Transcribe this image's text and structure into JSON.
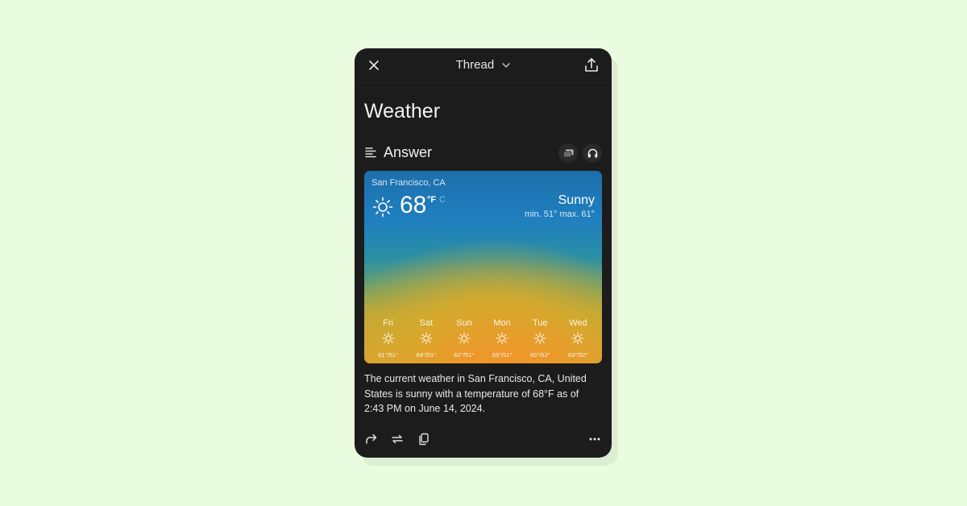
{
  "header": {
    "title": "Thread",
    "close_icon": "close-icon",
    "dropdown_icon": "chevron-down-icon",
    "share_icon": "share-icon"
  },
  "page": {
    "title": "Weather"
  },
  "answer": {
    "label": "Answer",
    "icons": [
      "answer-lines-icon",
      "images-icon",
      "headphones-icon"
    ]
  },
  "weather": {
    "location": "San Francisco, CA",
    "temperature": "68",
    "unit_primary": "°F",
    "unit_secondary": "C",
    "condition": "Sunny",
    "min_max": "min. 51° max. 61°",
    "icon": "sun-icon",
    "colors": {
      "top": "#1d6fab",
      "middle": "#d6aa2c",
      "bottom": "#f0952a"
    },
    "forecast": [
      {
        "day": "Fri",
        "temps": "61°/51°",
        "icon": "sun-icon"
      },
      {
        "day": "Sat",
        "temps": "64°/51°",
        "icon": "sun-icon"
      },
      {
        "day": "Sun",
        "temps": "62°/51°",
        "icon": "sun-icon"
      },
      {
        "day": "Mon",
        "temps": "63°/51°",
        "icon": "sun-icon"
      },
      {
        "day": "Tue",
        "temps": "65°/52°",
        "icon": "sun-icon"
      },
      {
        "day": "Wed",
        "temps": "63°/52°",
        "icon": "sun-icon"
      }
    ]
  },
  "summary": "The current weather in San Francisco, CA, United States is sunny with a temperature of 68°F as of 2:43 PM on June 14, 2024.",
  "actions": [
    "share-forward-icon",
    "rewrite-icon",
    "copy-icon",
    "more-icon"
  ]
}
